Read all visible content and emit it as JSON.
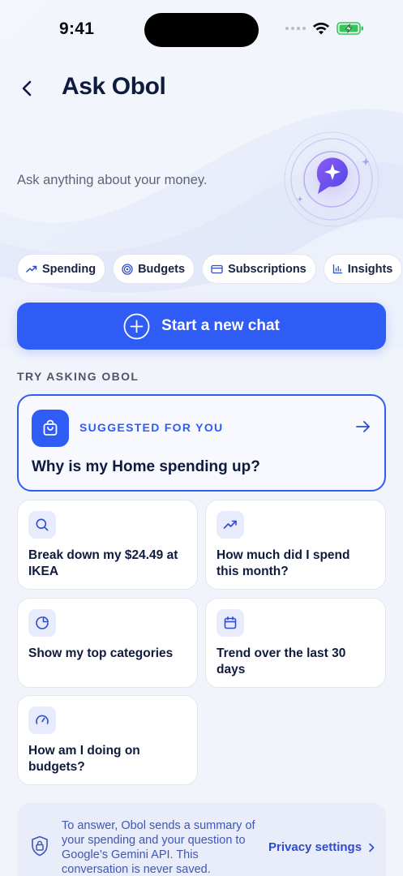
{
  "status_bar": {
    "time": "9:41"
  },
  "header": {
    "title": "Ask Obol",
    "subtitle": "Ask anything about your money."
  },
  "chips": [
    {
      "label": "Spending",
      "icon": "trending-up-icon"
    },
    {
      "label": "Budgets",
      "icon": "target-icon"
    },
    {
      "label": "Subscriptions",
      "icon": "credit-card-icon"
    },
    {
      "label": "Insights",
      "icon": "bar-chart-icon"
    }
  ],
  "new_chat": {
    "label": "Start a new chat"
  },
  "section": {
    "label": "TRY ASKING OBOL"
  },
  "suggested": {
    "label": "SUGGESTED FOR YOU",
    "question": "Why is my Home spending up?"
  },
  "questions": [
    {
      "text": "Break down my $24.49 at IKEA",
      "icon": "search-icon"
    },
    {
      "text": "How much did I spend this month?",
      "icon": "trending-up-icon"
    },
    {
      "text": "Show my top categories",
      "icon": "pie-chart-icon"
    },
    {
      "text": "Trend over the last 30 days",
      "icon": "calendar-icon"
    },
    {
      "text": "How am I doing on budgets?",
      "icon": "gauge-icon"
    }
  ],
  "privacy": {
    "text": "To answer, Obol sends a summary of your spending and your question to Google’s Gemini API. This conversation is never saved.",
    "link": "Privacy settings"
  },
  "colors": {
    "accent": "#2f5cf5",
    "background": "#f1f4fb",
    "battery": "#34c759"
  }
}
